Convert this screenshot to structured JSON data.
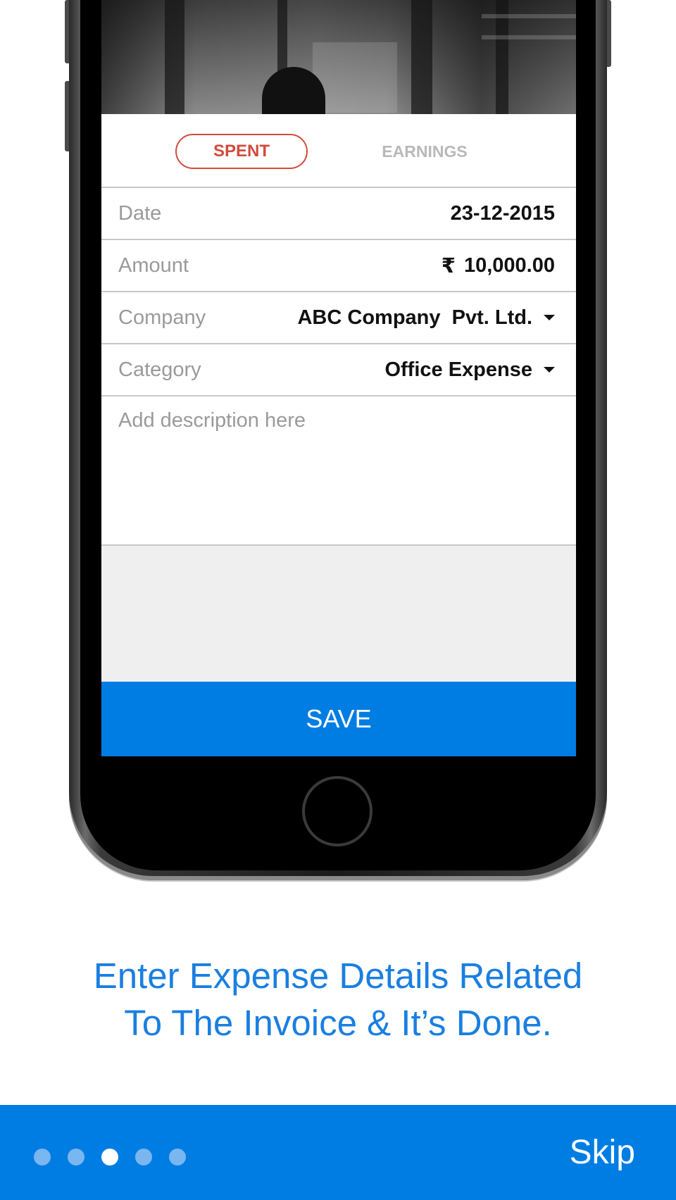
{
  "form": {
    "tabs": {
      "spent": "SPENT",
      "earnings": "EARNINGS"
    },
    "rows": [
      {
        "label": "Date",
        "value": "23-12-2015"
      },
      {
        "label": "Amount",
        "currency": "₹",
        "value": "10,000.00"
      },
      {
        "label": "Company",
        "value": "ABC Company  Pvt. Ltd."
      },
      {
        "label": "Category",
        "value": "Office Expense"
      }
    ],
    "description_placeholder": "Add description here",
    "save_label": "SAVE"
  },
  "caption": {
    "line1": "Enter Expense Details Related",
    "line2": "To The Invoice & It’s Done."
  },
  "footer": {
    "skip_label": "Skip",
    "pages_total": 5,
    "active_page": 3
  },
  "colors": {
    "primary": "#007de3",
    "spent_accent": "#d14b3b",
    "caption": "#1a7fe0"
  },
  "icons": {
    "dropdown": "caret-down-icon",
    "currency": "rupee-icon"
  }
}
